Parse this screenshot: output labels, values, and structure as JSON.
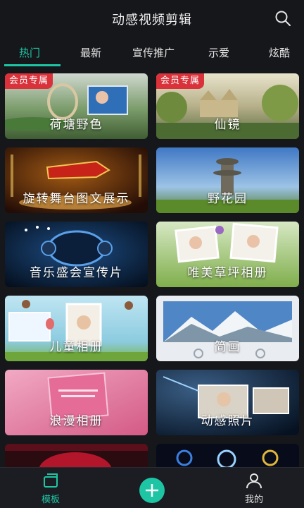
{
  "header": {
    "title": "动感视频剪辑",
    "search_icon": "search-icon"
  },
  "tabs": [
    {
      "label": "热门",
      "active": true
    },
    {
      "label": "最新"
    },
    {
      "label": "宣传推广"
    },
    {
      "label": "示爱"
    },
    {
      "label": "炫酷"
    }
  ],
  "templates": [
    {
      "label": "荷塘野色",
      "badge": "会员专属"
    },
    {
      "label": "仙镜",
      "badge": "会员专属"
    },
    {
      "label": "旋转舞台图文展示",
      "badge": ""
    },
    {
      "label": "野花园",
      "badge": ""
    },
    {
      "label": "音乐盛会宣传片",
      "badge": ""
    },
    {
      "label": "唯美草坪相册",
      "badge": ""
    },
    {
      "label": "儿童相册",
      "badge": ""
    },
    {
      "label": "简画",
      "badge": ""
    },
    {
      "label": "浪漫相册",
      "badge": ""
    },
    {
      "label": "动感照片",
      "badge": ""
    }
  ],
  "bottom_nav": {
    "templates_label": "模板",
    "templates_icon": "templates-icon",
    "add_icon": "plus-icon",
    "mine_label": "我的",
    "mine_icon": "user-icon"
  },
  "colors": {
    "accent": "#1ec5a5",
    "badge": "#d9323a",
    "background": "#16171b"
  }
}
